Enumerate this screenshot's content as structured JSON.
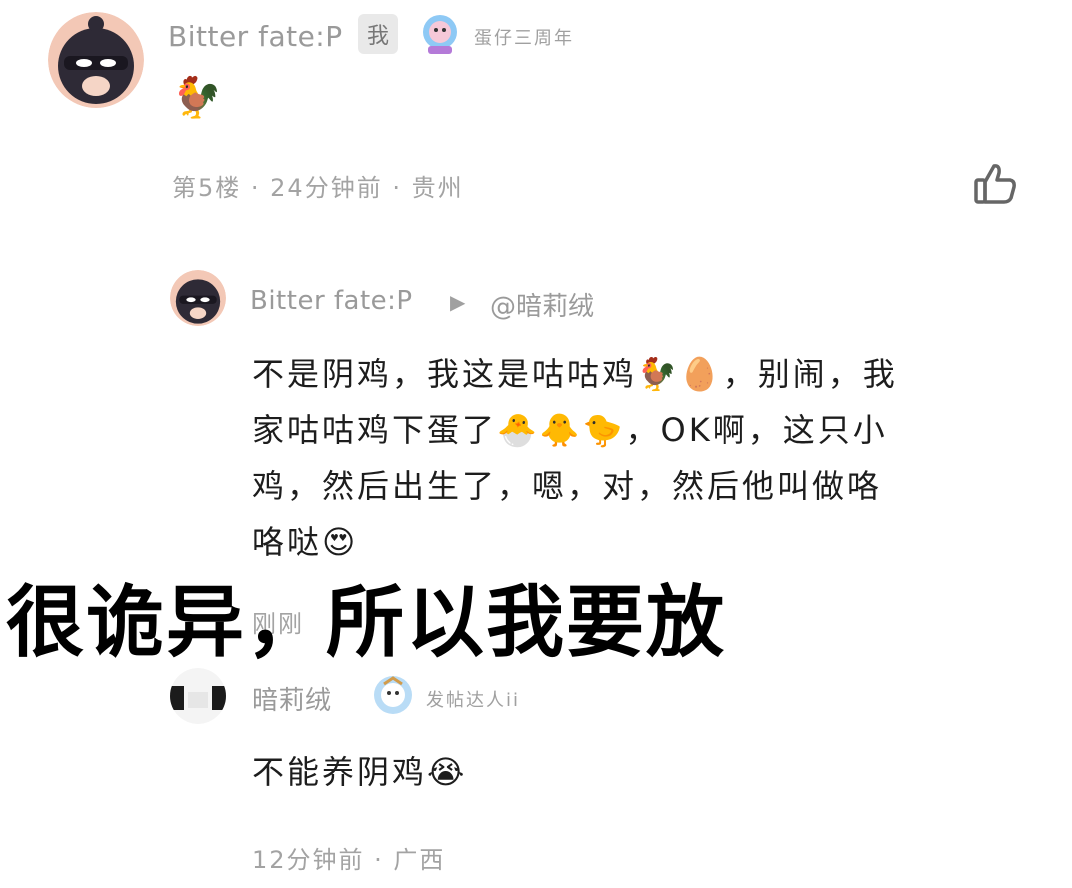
{
  "comment": {
    "username": "Bitter fate:P",
    "self_badge": "我",
    "medal_label": "蛋仔三周年",
    "content_emoji": "🐓",
    "meta": "第5楼 · 24分钟前 · 贵州",
    "like_icon": "thumbs-up-icon"
  },
  "reply1": {
    "username": "Bitter fate:P",
    "reply_to": "@暗莉绒",
    "content_lines": [
      "不是阴鸡，我这是咕咕鸡🐓🥚，别闹，我",
      "家咕咕鸡下蛋了🐣🐥🐤，OK啊，这只小",
      "鸡，然后出生了，嗯，对，然后他叫做咯",
      "咯哒😍"
    ],
    "time": "刚刚"
  },
  "reply2": {
    "username": "暗莉绒",
    "medal_label": "发帖达人ii",
    "content": "不能养阴鸡",
    "content_emoji": "😭",
    "meta": "12分钟前 · 广西"
  },
  "overlay_caption": "很诡异，所以我要放"
}
